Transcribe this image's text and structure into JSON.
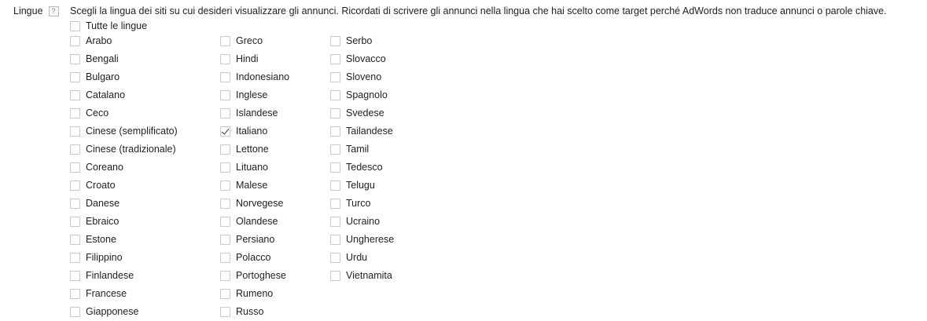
{
  "field": {
    "label": "Lingue",
    "help_glyph": "?",
    "description": "Scegli la lingua dei siti su cui desideri visualizzare gli annunci. Ricordati di scrivere gli annunci nella lingua che hai scelto come target perché AdWords non traduce annunci o parole chiave."
  },
  "all_languages": {
    "label": "Tutte le lingue",
    "checked": false
  },
  "columns": [
    [
      {
        "label": "Arabo",
        "checked": false
      },
      {
        "label": "Bengali",
        "checked": false
      },
      {
        "label": "Bulgaro",
        "checked": false
      },
      {
        "label": "Catalano",
        "checked": false
      },
      {
        "label": "Ceco",
        "checked": false
      },
      {
        "label": "Cinese (semplificato)",
        "checked": false
      },
      {
        "label": "Cinese (tradizionale)",
        "checked": false
      },
      {
        "label": "Coreano",
        "checked": false
      },
      {
        "label": "Croato",
        "checked": false
      },
      {
        "label": "Danese",
        "checked": false
      },
      {
        "label": "Ebraico",
        "checked": false
      },
      {
        "label": "Estone",
        "checked": false
      },
      {
        "label": "Filippino",
        "checked": false
      },
      {
        "label": "Finlandese",
        "checked": false
      },
      {
        "label": "Francese",
        "checked": false
      },
      {
        "label": "Giapponese",
        "checked": false
      }
    ],
    [
      {
        "label": "Greco",
        "checked": false
      },
      {
        "label": "Hindi",
        "checked": false
      },
      {
        "label": "Indonesiano",
        "checked": false
      },
      {
        "label": "Inglese",
        "checked": false
      },
      {
        "label": "Islandese",
        "checked": false
      },
      {
        "label": "Italiano",
        "checked": true
      },
      {
        "label": "Lettone",
        "checked": false
      },
      {
        "label": "Lituano",
        "checked": false
      },
      {
        "label": "Malese",
        "checked": false
      },
      {
        "label": "Norvegese",
        "checked": false
      },
      {
        "label": "Olandese",
        "checked": false
      },
      {
        "label": "Persiano",
        "checked": false
      },
      {
        "label": "Polacco",
        "checked": false
      },
      {
        "label": "Portoghese",
        "checked": false
      },
      {
        "label": "Rumeno",
        "checked": false
      },
      {
        "label": "Russo",
        "checked": false
      }
    ],
    [
      {
        "label": "Serbo",
        "checked": false
      },
      {
        "label": "Slovacco",
        "checked": false
      },
      {
        "label": "Sloveno",
        "checked": false
      },
      {
        "label": "Spagnolo",
        "checked": false
      },
      {
        "label": "Svedese",
        "checked": false
      },
      {
        "label": "Tailandese",
        "checked": false
      },
      {
        "label": "Tamil",
        "checked": false
      },
      {
        "label": "Tedesco",
        "checked": false
      },
      {
        "label": "Telugu",
        "checked": false
      },
      {
        "label": "Turco",
        "checked": false
      },
      {
        "label": "Ucraino",
        "checked": false
      },
      {
        "label": "Ungherese",
        "checked": false
      },
      {
        "label": "Urdu",
        "checked": false
      },
      {
        "label": "Vietnamita",
        "checked": false
      }
    ]
  ]
}
